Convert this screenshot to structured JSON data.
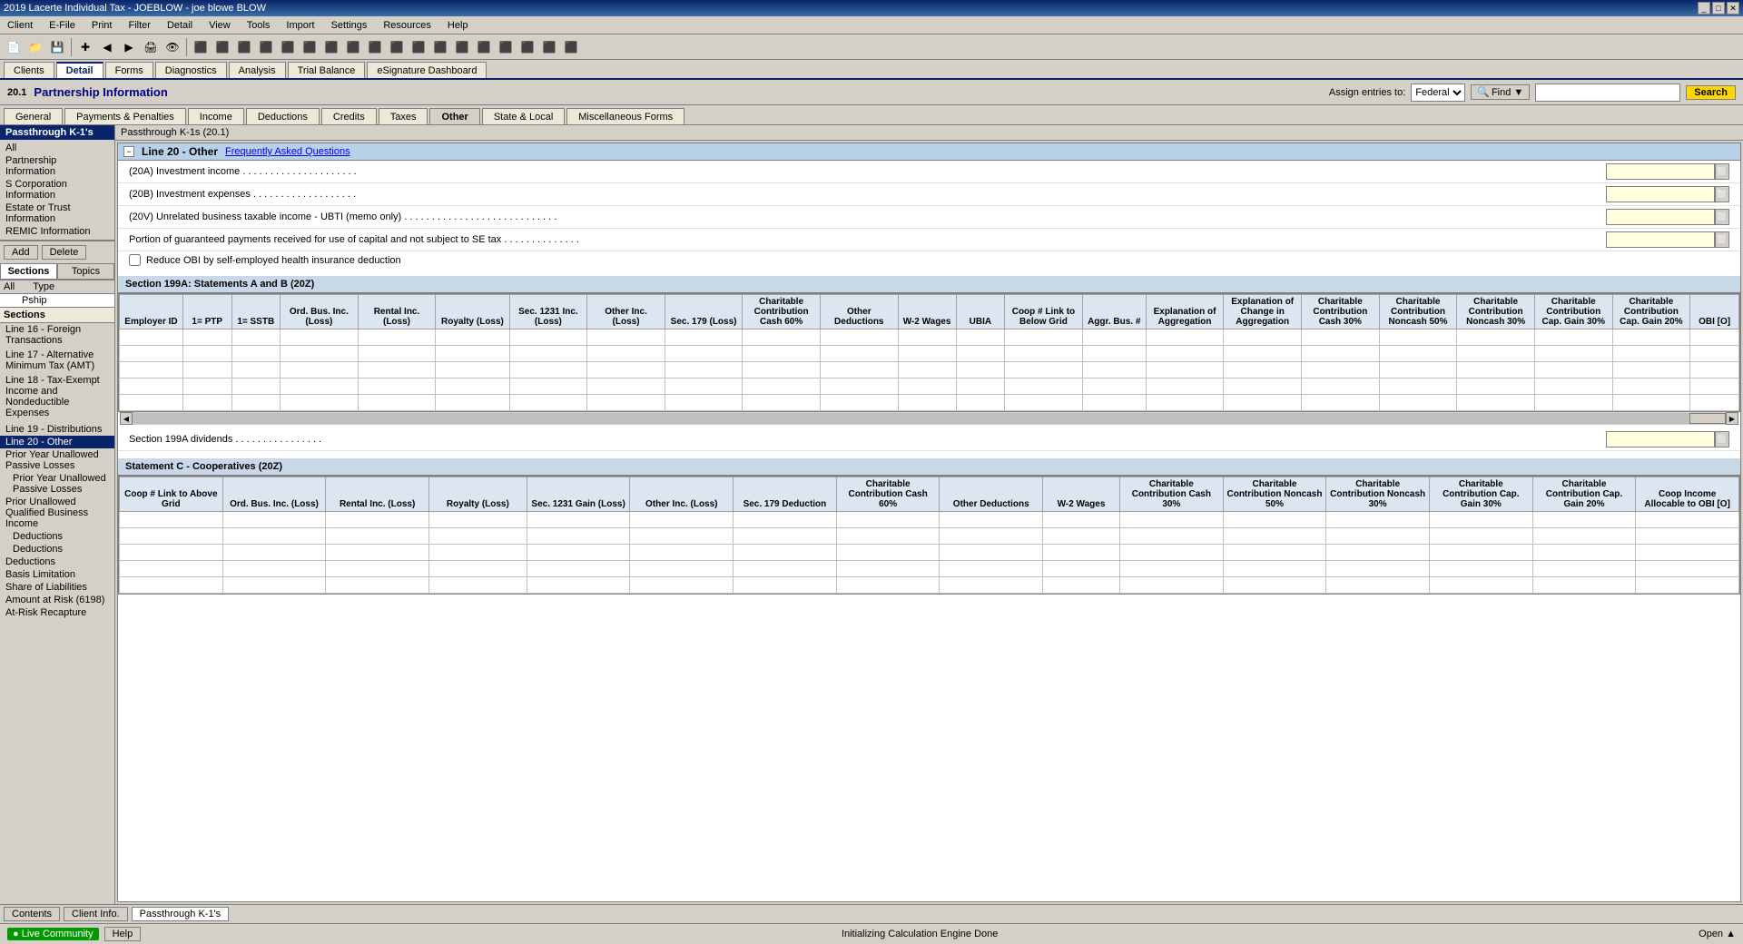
{
  "titleBar": {
    "title": "2019 Lacerte Individual Tax - JOEBLOW - joe blowe BLOW",
    "buttons": [
      "_",
      "□",
      "✕"
    ]
  },
  "menuBar": {
    "items": [
      "Client",
      "E-File",
      "Print",
      "Filter",
      "Detail",
      "View",
      "Tools",
      "Import",
      "Settings",
      "Resources",
      "Help"
    ]
  },
  "tabBar": {
    "tabs": [
      "Clients",
      "Detail",
      "Forms",
      "Diagnostics",
      "Analysis",
      "Trial Balance",
      "eSignature Dashboard"
    ]
  },
  "header": {
    "moduleId": "20.1",
    "moduleTitle": "Partnership Information",
    "assignLabel": "Assign entries to:",
    "assignValue": "Federal",
    "findLabel": "Find ▼",
    "searchPlaceholder": "",
    "searchLabel": "Search"
  },
  "navTabs": {
    "tabs": [
      "General",
      "Payments & Penalties",
      "Income",
      "Deductions",
      "Credits",
      "Taxes",
      "Other",
      "State & Local",
      "Miscellaneous Forms"
    ]
  },
  "sidebar": {
    "header": "Passthrough K-1's",
    "items": [
      "All",
      "Partnership Information",
      "S Corporation Information",
      "Estate or Trust Information",
      "REMIC Information"
    ],
    "addLabel": "Add",
    "deleteLabel": "Delete",
    "tabs": [
      "Sections",
      "Topics"
    ],
    "listHeader": [
      "All",
      "Type"
    ],
    "listItems": [
      {
        "col1": "",
        "col2": "Pship"
      }
    ],
    "sections": {
      "header": "Sections",
      "items": [
        "Line 16 - Foreign Transactions",
        "Line 17 - Alternative Minimum Tax (AMT)",
        "Line 18 - Tax-Exempt Income and Nondeductible Expenses",
        "Line 19 - Distributions",
        "Line 20 - Other",
        "Prior Year Unallowed Passive Losses",
        "Prior Unallowed Qualified Business Income",
        "Deductions",
        "Basis Limitation",
        "Share of Liabilities",
        "Amount at Risk (6198)",
        "At-Risk Recapture"
      ]
    }
  },
  "form": {
    "breadcrumb": "Passthrough K-1s (20.1)",
    "sectionTitle": "Line 20 - Other",
    "faqLabel": "Frequently Asked Questions",
    "fields": [
      {
        "label": "(20A) Investment income . . . . . . . . . . . . . . . . . . . . .",
        "id": "investment-income"
      },
      {
        "label": "(20B) Investment expenses . . . . . . . . . . . . . . . . . . .",
        "id": "investment-expenses"
      },
      {
        "label": "(20V) Unrelated business taxable income - UBTI (memo only) . . . . . . . . . . . . . . . . . . . . . . . . . . . .",
        "id": "ubti"
      },
      {
        "label": "Portion of guaranteed payments received for use of capital and not subject to SE tax . . . . . . . . . . . . . .",
        "id": "guaranteed-payments"
      }
    ],
    "checkbox": {
      "label": "Reduce OBI by self-employed health insurance deduction"
    },
    "section199A": {
      "title": "Section 199A: Statements A and B (20Z)",
      "columns": [
        "Employer ID",
        "1= PTP",
        "1= SSTB",
        "Ord. Bus. Inc. (Loss)",
        "Rental Inc. (Loss)",
        "Royalty (Loss)",
        "Sec. 1231 Inc. (Loss)",
        "Other Inc. (Loss)",
        "Sec. 179 (Loss)",
        "Charitable Contribution Cash 60%",
        "Other Deductions",
        "W-2 Wages",
        "UBIA",
        "Coop # Link to Below Grid",
        "Aggr. Bus. #",
        "Explanation of Aggregation",
        "Explanation of Change in Aggregation",
        "Charitable Contribution Cash 30%",
        "Charitable Contribution Noncash 50%",
        "Charitable Contribution Noncash 30%",
        "Charitable Contribution Cap. Gain 30%",
        "Charitable Contribution Cap. Gain 20%",
        "OBI [O]"
      ]
    },
    "section199ADividends": {
      "label": "Section 199A dividends . . . . . . . . . . . . . . . .",
      "id": "section199a-dividends"
    },
    "statementC": {
      "title": "Statement C - Cooperatives (20Z)",
      "columns": [
        "Coop # Link to Above Grid",
        "Ord. Bus. Inc. (Loss)",
        "Rental Inc. (Loss)",
        "Royalty (Loss)",
        "Sec. 1231 Gain (Loss)",
        "Other Inc. (Loss)",
        "Sec. 179 Deduction",
        "Charitable Contribution Cash 60%",
        "Other Deductions",
        "W-2 Wages",
        "Charitable Contribution Cash 30%",
        "Charitable Contribution Noncash 50%",
        "Charitable Contribution Noncash 30%",
        "Charitable Contribution Cap. Gain 30%",
        "Charitable Contribution Cap. Gain 20%",
        "Coop Income Allocable to OBI [O]"
      ]
    }
  },
  "bottomTabs": [
    "Contents",
    "Client Info.",
    "Passthrough K-1's"
  ],
  "statusBar": {
    "liveCommunityLabel": "Live Community",
    "helpLabel": "Help",
    "statusMessage": "Initializing Calculation Engine Done",
    "openLabel": "Open ▲"
  }
}
